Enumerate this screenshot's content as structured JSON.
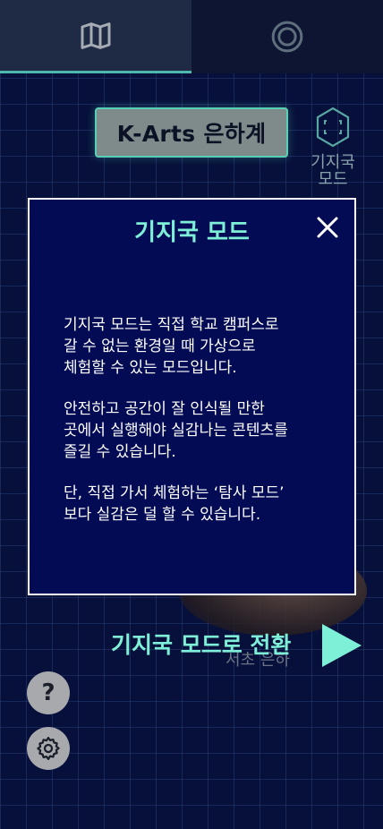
{
  "tabs": [
    {
      "name": "map",
      "icon": "map-icon",
      "active": true
    },
    {
      "name": "target",
      "icon": "target-icon",
      "active": false
    }
  ],
  "header": {
    "title": "K-Arts 은하계"
  },
  "base_mode_button": {
    "label": "기지국\n모드",
    "icon": "scan-hexagon-icon"
  },
  "modal": {
    "title": "기지국 모드",
    "paragraphs": [
      "기지국 모드는 직접 학교 캠퍼스로\n갈 수 없는 환경일 때 가상으로\n체험할 수 있는 모드입니다.",
      "안전하고 공간이 잘 인식될 만한\n곳에서 실행해야 실감나는 콘텐츠를\n즐길 수 있습니다.",
      "단, 직접 가서 체험하는 ‘탐사 모드’\n보다 실감은 덜 할 수 있습니다."
    ]
  },
  "switch_mode": {
    "label": "기지국 모드로 전환",
    "sub_label": "서초 은하"
  },
  "help_button": {
    "label": "?"
  },
  "colors": {
    "accent": "#7ff0d8",
    "background": "#07103a",
    "modal_bg": "#030b55"
  }
}
